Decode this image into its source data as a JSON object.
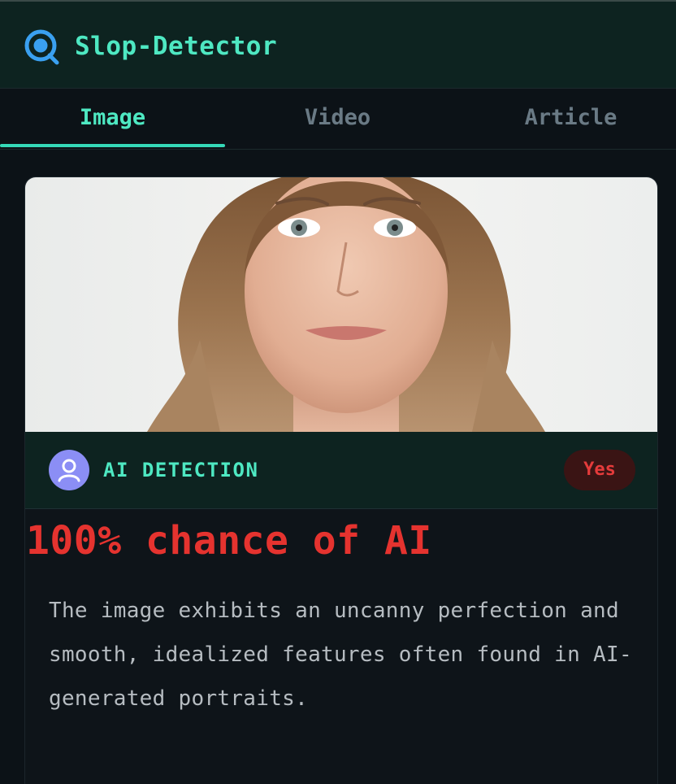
{
  "header": {
    "app_title": "Slop-Detector",
    "logo_icon": "magnifier-icon",
    "accent_color": "#4ee8c2"
  },
  "tabs": [
    {
      "label": "Image",
      "active": true
    },
    {
      "label": "Video",
      "active": false
    },
    {
      "label": "Article",
      "active": false
    }
  ],
  "result": {
    "image": "Portrait photo of a woman with long wavy light-brown hair, looking at the camera, plain white background",
    "avatar_icon": "user-icon",
    "detection_label": "AI DETECTION",
    "verdict": "Yes",
    "verdict_color": "#e53b3b",
    "score_text": "100% chance of AI",
    "explanation": "The image exhibits an uncanny perfection and smooth, idealized features often found in AI-generated portraits."
  }
}
